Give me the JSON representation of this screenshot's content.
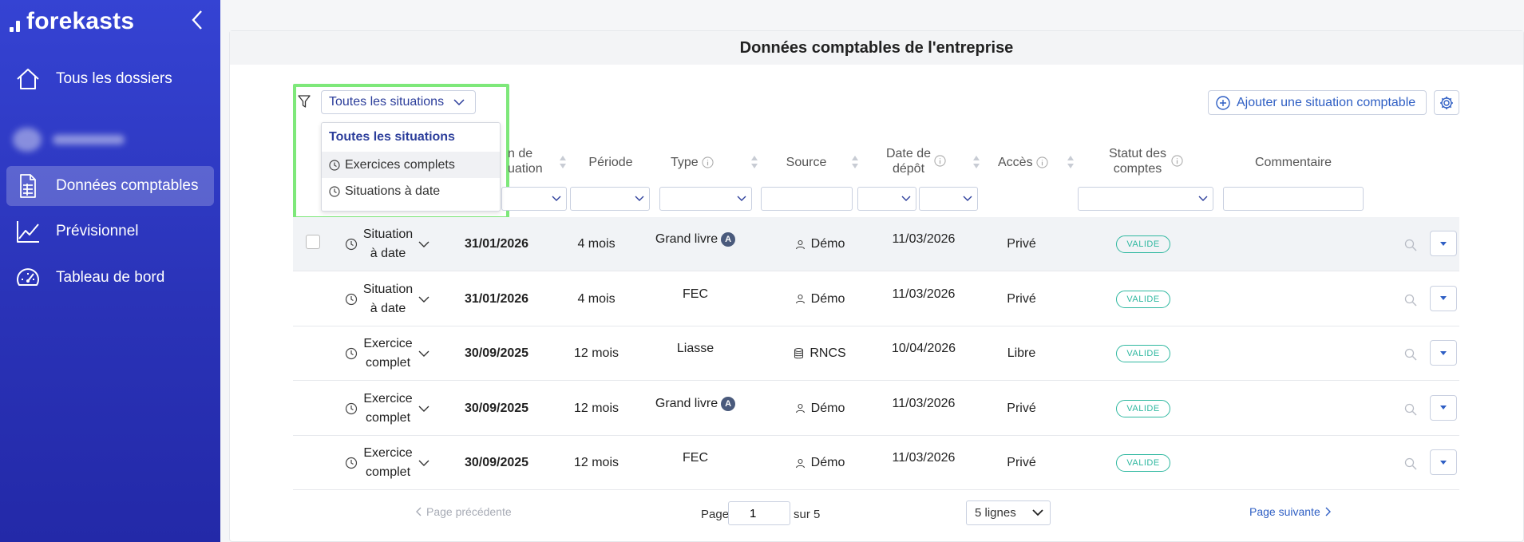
{
  "app": {
    "logo_text": "forekasts"
  },
  "sidebar": {
    "items": [
      {
        "label": "Tous les dossiers",
        "icon": "home-icon"
      },
      {
        "label": "Données comptables",
        "icon": "document-table-icon",
        "active": true
      },
      {
        "label": "Prévisionnel",
        "icon": "line-chart-icon"
      },
      {
        "label": "Tableau de bord",
        "icon": "gauge-icon"
      }
    ],
    "blurred_company": "ARTCOACT"
  },
  "panel": {
    "title": "Données comptables de l'entreprise"
  },
  "filter": {
    "selected": "Toutes les situations",
    "options": [
      "Toutes les situations",
      "Exercices complets",
      "Situations à date"
    ]
  },
  "toolbar": {
    "add_label": "Ajouter une situation comptable"
  },
  "columns": {
    "date_fin": "n de\nuation",
    "periode": "Période",
    "type": "Type",
    "source": "Source",
    "depot": "Date de\ndépôt",
    "acces": "Accès",
    "statut": "Statut des\ncomptes",
    "commentaire": "Commentaire"
  },
  "rows": [
    {
      "situation": "Situation à date",
      "icon": "clock-icon",
      "date": "31/01/2026",
      "periode": "4 mois",
      "type": "Grand livre",
      "type_badge": "A",
      "source": "Démo",
      "source_icon": "user-icon",
      "depot": "11/03/2026",
      "acces": "Privé",
      "statut": "VALIDE"
    },
    {
      "situation": "Situation à date",
      "icon": "clock-icon",
      "date": "31/01/2026",
      "periode": "4 mois",
      "type": "FEC",
      "type_badge": "",
      "source": "Démo",
      "source_icon": "user-icon",
      "depot": "11/03/2026",
      "acces": "Privé",
      "statut": "VALIDE"
    },
    {
      "situation": "Exercice complet",
      "icon": "clock-icon",
      "date": "30/09/2025",
      "periode": "12 mois",
      "type": "Liasse",
      "type_badge": "",
      "source": "RNCS",
      "source_icon": "database-icon",
      "depot": "10/04/2026",
      "acces": "Libre",
      "statut": "VALIDE"
    },
    {
      "situation": "Exercice complet",
      "icon": "clock-icon",
      "date": "30/09/2025",
      "periode": "12 mois",
      "type": "Grand livre",
      "type_badge": "A",
      "source": "Démo",
      "source_icon": "user-icon",
      "depot": "11/03/2026",
      "acces": "Privé",
      "statut": "VALIDE"
    },
    {
      "situation": "Exercice complet",
      "icon": "clock-icon",
      "date": "30/09/2025",
      "periode": "12 mois",
      "type": "FEC",
      "type_badge": "",
      "source": "Démo",
      "source_icon": "user-icon",
      "depot": "11/03/2026",
      "acces": "Privé",
      "statut": "VALIDE"
    }
  ],
  "pagination": {
    "prev_label": "Page précédente",
    "page_label": "Page",
    "page_value": "1",
    "total_label": "sur 5",
    "rows_per_page": "5 lignes",
    "next_label": "Page suivante"
  },
  "colors": {
    "sidebar": "#2f3ac4",
    "accent": "#2f5fc4",
    "valid": "#2fb8a0",
    "highlight": "#7ee87a"
  }
}
